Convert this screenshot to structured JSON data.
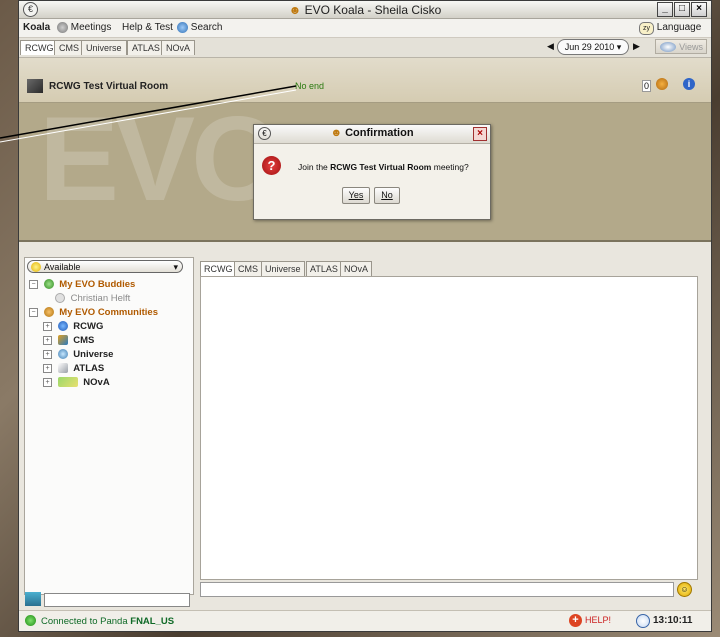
{
  "window": {
    "title": "EVO Koala  - Sheila Cisko",
    "controls": [
      "minimize",
      "maximize",
      "close"
    ]
  },
  "menubar": {
    "app": "Koala",
    "meetings": "Meetings",
    "help_test": "Help & Test",
    "search": "Search",
    "language": "Language",
    "language_badge": "zy"
  },
  "community_tabs": [
    "RCWG",
    "CMS",
    "Universe",
    "ATLAS",
    "NOvA"
  ],
  "date": "Jun 29 2010",
  "views_label": "Views",
  "room": {
    "watermark": "EVO",
    "title": "RCWG Test Virtual Room",
    "status": "No end",
    "participant_count": "0"
  },
  "dialog": {
    "title": "Confirmation",
    "message_prefix": "Join the ",
    "message_bold": "RCWG Test Virtual Room",
    "message_suffix": " meeting?",
    "yes": "Yes",
    "no": "No"
  },
  "left_panel": {
    "status": "Available",
    "buddies_label": "My EVO Buddies",
    "buddies": [
      "Christian Helft"
    ],
    "communities_label": "My EVO Communities",
    "communities": [
      "RCWG",
      "CMS",
      "Universe",
      "ATLAS",
      "NOvA"
    ]
  },
  "chat_tabs": [
    "RCWG",
    "CMS",
    "Universe",
    "ATLAS",
    "NOvA"
  ],
  "statusbar": {
    "connected_prefix": "Connected to Panda ",
    "connected_server": "FNAL_US",
    "help": "HELP!",
    "time": "13:10:11"
  },
  "colors": {
    "accent_green": "#2a7a10",
    "community_orange": "#b05a00",
    "room_background": "#b3a98a",
    "help_red": "#cc2222"
  }
}
